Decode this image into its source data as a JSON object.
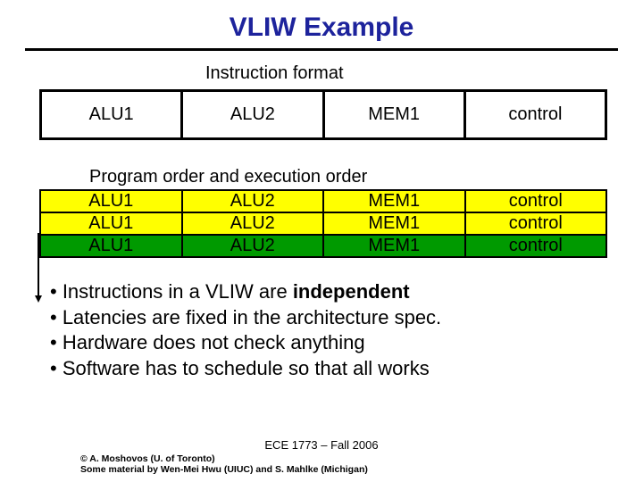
{
  "title": "VLIW Example",
  "sub1": "Instruction format",
  "format": {
    "c1": "ALU1",
    "c2": "ALU2",
    "c3": "MEM1",
    "c4": "control"
  },
  "sub2": "Program order and execution order",
  "orders": [
    {
      "c1": "ALU1",
      "c2": "ALU2",
      "c3": "MEM1",
      "c4": "control"
    },
    {
      "c1": "ALU1",
      "c2": "ALU2",
      "c3": "MEM1",
      "c4": "control"
    },
    {
      "c1": "ALU1",
      "c2": "ALU2",
      "c3": "MEM1",
      "c4": "control"
    }
  ],
  "bullets": {
    "b1a": "• Instructions in a VLIW are ",
    "b1b": "independent",
    "b2": "• Latencies are fixed in the architecture spec.",
    "b3": "• Hardware does not check anything",
    "b4": "• Software has to schedule so that all works"
  },
  "footer": {
    "course": "ECE 1773 – Fall 2006",
    "credit1": "© A. Moshovos (U. of Toronto)",
    "credit2": "Some material by Wen-Mei Hwu (UIUC) and S. Mahlke (Michigan)"
  }
}
